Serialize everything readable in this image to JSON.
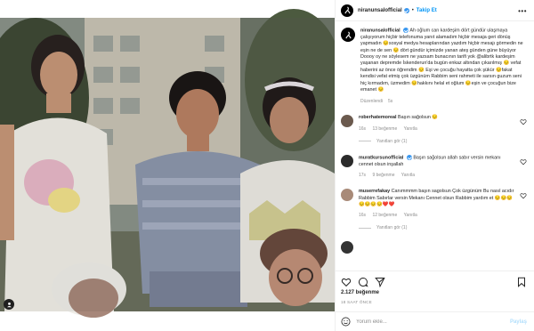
{
  "post": {
    "username": "niranunsalofficial",
    "follow_label": "Takip Et",
    "more_label": "•••",
    "caption_text": "Ah oğlum can kardeşim dört gündür ulaşmaya çalışıyorum hiçbir telefonuma yanıt alamadım hiçbir mesaja geri dönüş yapmadın 😔sosyal medya hesaplarından yazdım hiçbir mesajı görmedin ne eşin ne de sen 😔 dört gündür içimizde yanan ateş günden güne büyüyor Doooy oy ne söylesem ne yazsam bunacının tarifi yok @alibrtk kardeşim yaşanan depremde İskenderun'da bugün enkaz altından çıkarılmış 😔 vefat haberini az önce öğrendim 😔 Eşi ve çocuğu hayatta çok şükür 😔fakat kendisi vefat etmiş çok üzgünüm Rabbim seni rahmeti ile sarsın guzum seni hiç kırmadım, üzmedim 😔hakkını helal et oğlum 😔eşin ve çocuğun bize emanet 😔",
    "edited_label": "Düzenlendi",
    "edited_age": "5s",
    "likes": "2.127 beğenme",
    "timestamp": "18 SAAT ÖNCE",
    "comment_placeholder": "Yorum ekle...",
    "post_label": "Paylaş"
  },
  "comments": [
    {
      "username": "roberhatemoreal",
      "text": "Başın sağolsun 😔",
      "age": "16s",
      "likes": "13 beğenme",
      "reply": "Yanıtla",
      "replies": "Yanıtları gör (1)",
      "avatar_color": "#6b5a4e"
    },
    {
      "username": "muratkursunofficial",
      "text": "Başın sağolsun allah sabır versin mekanı cennet olsun inşallah",
      "age": "17s",
      "likes": "9 beğenme",
      "reply": "Yanıtla",
      "replies": "",
      "avatar_color": "#2b2b2b"
    },
    {
      "username": "muserrefakay",
      "text": "Canımmmm başın sagolsun Çok üzgünüm Bu nasıl acıdır Rabbim Sabırlar versin Mekanı Cennet olsun Rabbim yardım et 😔😔😔😔😔😔😔❤️❤️",
      "age": "16s",
      "likes": "12 beğenme",
      "reply": "Yanıtla",
      "replies": "Yanıtları gör (1)",
      "avatar_color": "#a88a78"
    },
    {
      "username": "",
      "text": "",
      "age": "",
      "likes": "",
      "reply": "",
      "replies": "",
      "avatar_color": "#333333"
    }
  ],
  "icons": {
    "like": "heart-icon",
    "comment": "comment-icon",
    "share": "share-icon",
    "save": "bookmark-icon",
    "verified": "verified-badge-icon",
    "user_tag": "user-tag-icon"
  },
  "colors": {
    "accent": "#0095f6",
    "verified": "#3897f0",
    "muted": "#8e8e8e"
  }
}
